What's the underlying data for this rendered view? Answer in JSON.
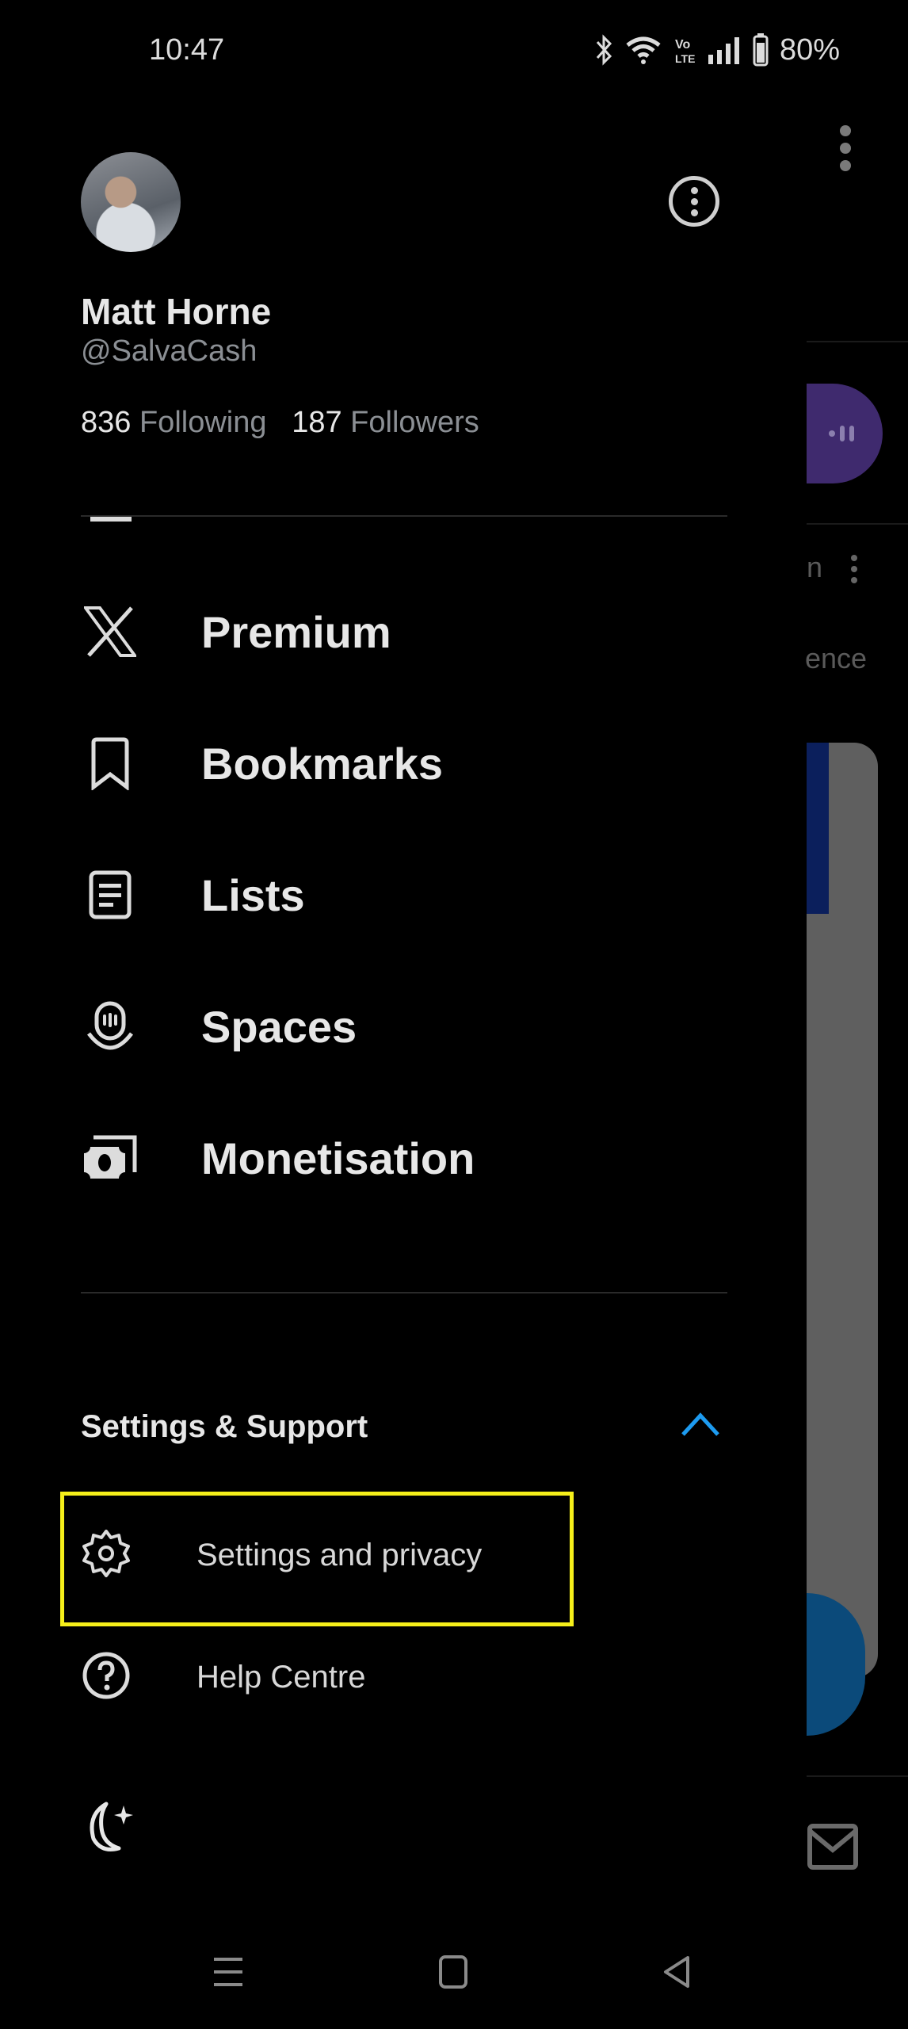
{
  "status_bar": {
    "time": "10:47",
    "battery": "80%",
    "icons": [
      "bluetooth-icon",
      "wifi-icon",
      "volte-icon",
      "signal-icon",
      "battery-icon"
    ]
  },
  "profile": {
    "name": "Matt Horne",
    "handle": "@SalvaCash",
    "following_count": "836",
    "following_label": "Following",
    "followers_count": "187",
    "followers_label": "Followers"
  },
  "nav_items": [
    {
      "label": "Premium",
      "icon": "x-logo-icon"
    },
    {
      "label": "Bookmarks",
      "icon": "bookmark-icon"
    },
    {
      "label": "Lists",
      "icon": "list-icon"
    },
    {
      "label": "Spaces",
      "icon": "spaces-icon"
    },
    {
      "label": "Monetisation",
      "icon": "money-icon"
    }
  ],
  "settings_section": {
    "title": "Settings & Support",
    "expanded": true,
    "accent": "#1d9bf0",
    "items": [
      {
        "label": "Settings and privacy",
        "icon": "gear-icon",
        "highlighted": true
      },
      {
        "label": "Help Centre",
        "icon": "help-icon"
      }
    ]
  },
  "highlight_color": "#f5ef1a",
  "background_app": {
    "partial_text_1": "n",
    "partial_text_2": "ence"
  }
}
